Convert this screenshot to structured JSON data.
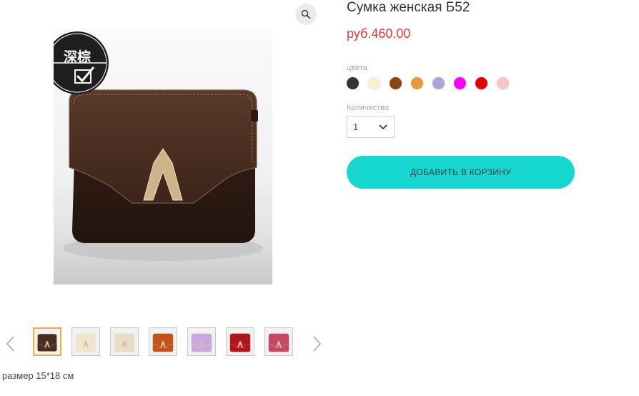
{
  "product": {
    "title": "Сумка женская Б52",
    "price": "руб.460.00",
    "description": "размер 15*18 см",
    "image_badge": "深棕",
    "colors_label": "цвета",
    "colors": [
      "#333333",
      "#fdf0d2",
      "#8b4513",
      "#e79a3c",
      "#b3a2d9",
      "#ff00ff",
      "#e00000",
      "#f5c6c9"
    ],
    "quantity_label": "Количество",
    "quantity_value": "1",
    "add_to_cart_label": "ДОБАВИТЬ В КОРЗИНУ"
  },
  "thumbnails": [
    {
      "name": "thumb-dark-brown",
      "color": "#4a2e1f",
      "active": true
    },
    {
      "name": "thumb-cream",
      "color": "#efe6cf",
      "active": false
    },
    {
      "name": "thumb-model",
      "color": "#e8dcc8",
      "active": false
    },
    {
      "name": "thumb-orange",
      "color": "#c1541c",
      "active": false
    },
    {
      "name": "thumb-lilac",
      "color": "#c9a9dd",
      "active": false
    },
    {
      "name": "thumb-red",
      "color": "#b0141c",
      "active": false
    },
    {
      "name": "thumb-pink",
      "color": "#c44a63",
      "active": false
    }
  ],
  "icons": {
    "zoom": "magnifier-icon",
    "prev": "chevron-left-icon",
    "next": "chevron-right-icon",
    "select": "chevron-down-icon"
  }
}
